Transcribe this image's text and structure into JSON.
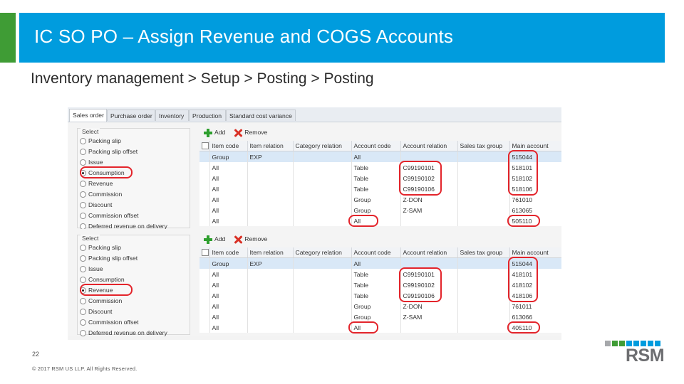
{
  "slide": {
    "title": "IC SO PO – Assign Revenue and COGS Accounts",
    "subtitle": "Inventory management > Setup > Posting > Posting",
    "slide_number": "22",
    "copyright": "© 2017 RSM US LLP. All Rights Reserved.",
    "logo_text": "RSM",
    "colors": {
      "accent_blue": "#009cde",
      "accent_green": "#3f9c35",
      "highlight_red": "#e3242b",
      "logo_gray": "#6d6e71"
    }
  },
  "screenshot": {
    "tabs": [
      "Sales order",
      "Purchase order",
      "Inventory",
      "Production",
      "Standard cost variance"
    ],
    "active_tab": "Sales order",
    "panels": [
      {
        "select_title": "Select",
        "options": [
          "Packing slip",
          "Packing slip offset",
          "Issue",
          "Consumption",
          "Revenue",
          "Commission",
          "Discount",
          "Commission offset",
          "Deferred revenue on delivery"
        ],
        "selected_option": "Consumption",
        "toolbar": {
          "add_label": "Add",
          "remove_label": "Remove",
          "add_icon": "plus-icon",
          "remove_icon": "delete-icon"
        },
        "columns": [
          "Item code",
          "Item relation",
          "Category relation",
          "Account code",
          "Account relation",
          "Sales tax group",
          "Main account"
        ],
        "rows": [
          [
            "Group",
            "EXP",
            "",
            "All",
            "",
            "",
            "515044"
          ],
          [
            "All",
            "",
            "",
            "Table",
            "C99190101",
            "",
            "518101"
          ],
          [
            "All",
            "",
            "",
            "Table",
            "C99190102",
            "",
            "518102"
          ],
          [
            "All",
            "",
            "",
            "Table",
            "C99190106",
            "",
            "518106"
          ],
          [
            "All",
            "",
            "",
            "Group",
            "Z-DON",
            "",
            "761010"
          ],
          [
            "All",
            "",
            "",
            "Group",
            "Z-SAM",
            "",
            "613065"
          ],
          [
            "All",
            "",
            "",
            "All",
            "",
            "",
            "505110"
          ]
        ]
      },
      {
        "select_title": "Select",
        "options": [
          "Packing slip",
          "Packing slip offset",
          "Issue",
          "Consumption",
          "Revenue",
          "Commission",
          "Discount",
          "Commission offset",
          "Deferred revenue on delivery"
        ],
        "selected_option": "Revenue",
        "toolbar": {
          "add_label": "Add",
          "remove_label": "Remove",
          "add_icon": "plus-icon",
          "remove_icon": "delete-icon"
        },
        "columns": [
          "Item code",
          "Item relation",
          "Category relation",
          "Account code",
          "Account relation",
          "Sales tax group",
          "Main account"
        ],
        "rows": [
          [
            "Group",
            "EXP",
            "",
            "All",
            "",
            "",
            "515044"
          ],
          [
            "All",
            "",
            "",
            "Table",
            "C99190101",
            "",
            "418101"
          ],
          [
            "All",
            "",
            "",
            "Table",
            "C99190102",
            "",
            "418102"
          ],
          [
            "All",
            "",
            "",
            "Table",
            "C99190106",
            "",
            "418106"
          ],
          [
            "All",
            "",
            "",
            "Group",
            "Z-DON",
            "",
            "761011"
          ],
          [
            "All",
            "",
            "",
            "Group",
            "Z-SAM",
            "",
            "613066"
          ],
          [
            "All",
            "",
            "",
            "All",
            "",
            "",
            "405110"
          ]
        ]
      }
    ]
  }
}
